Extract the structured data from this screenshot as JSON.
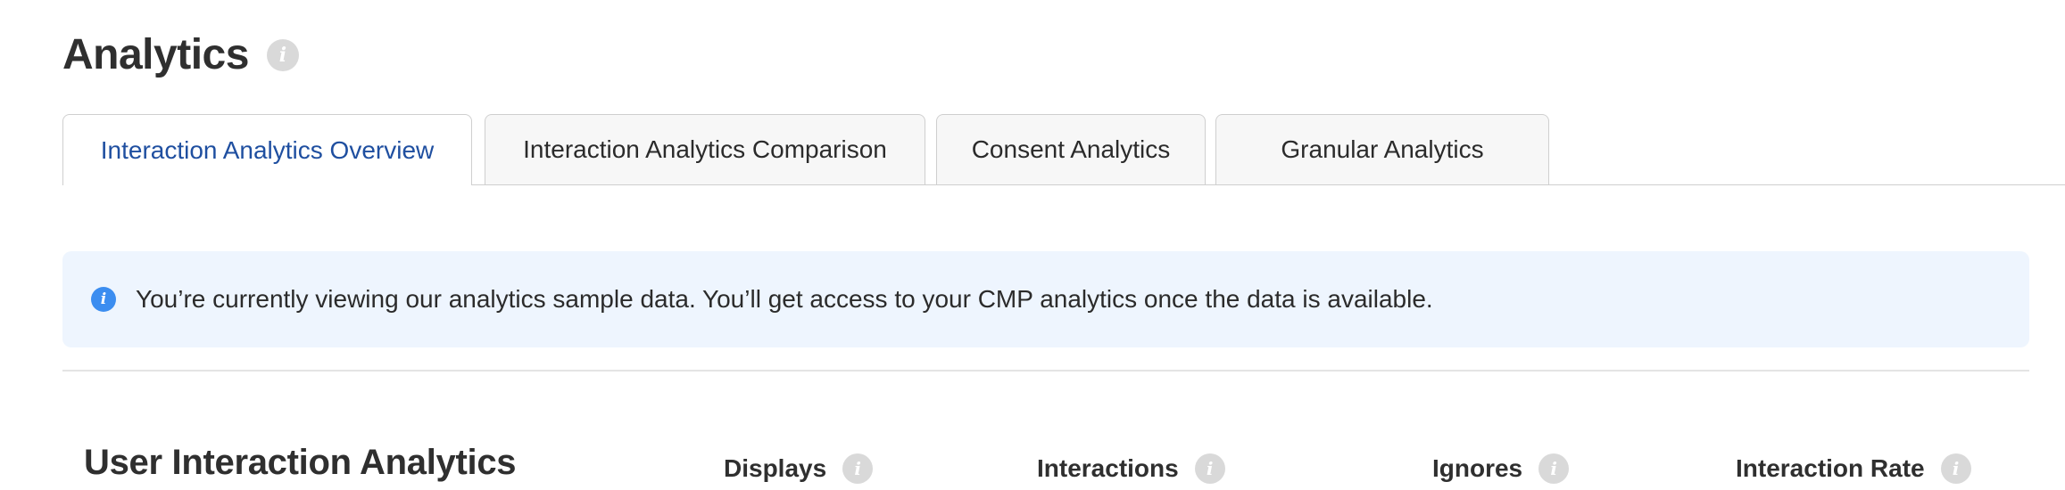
{
  "header": {
    "title": "Analytics",
    "info_icon": "info-icon"
  },
  "tabs": [
    {
      "label": "Interaction Analytics Overview",
      "active": true
    },
    {
      "label": "Interaction Analytics Comparison",
      "active": false
    },
    {
      "label": "Consent Analytics",
      "active": false
    },
    {
      "label": "Granular Analytics",
      "active": false
    }
  ],
  "notice": {
    "icon": "info-icon",
    "text": "You’re currently viewing our analytics sample data. You’ll get access to your CMP analytics once the data is available."
  },
  "section": {
    "title": "User Interaction Analytics",
    "metrics": [
      {
        "label": "Displays",
        "icon": "info-icon"
      },
      {
        "label": "Interactions",
        "icon": "info-icon"
      },
      {
        "label": "Ignores",
        "icon": "info-icon"
      },
      {
        "label": "Interaction Rate",
        "icon": "info-icon"
      }
    ]
  },
  "colors": {
    "active_tab_text": "#1f4fa0",
    "notice_background": "#eef5fe",
    "notice_icon": "#3b8df0",
    "info_icon_gray": "#d9d9d9"
  }
}
